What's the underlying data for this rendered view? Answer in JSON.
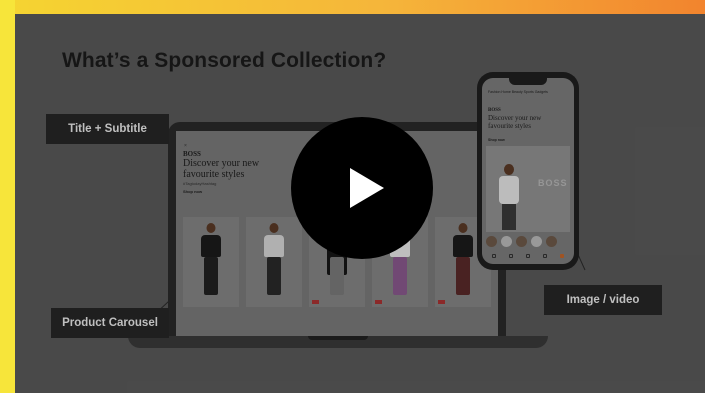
{
  "video": {
    "heading": "What’s a Sponsored Collection?",
    "callouts": {
      "title_subtitle": "Title + Subtitle",
      "product_carousel": "Product Carousel",
      "image_video": "Image / video"
    },
    "play_icon": "play-icon"
  },
  "laptop": {
    "brand": "BOSS",
    "subtitle": "Discover your new favourite styles",
    "tag": "#TagtodayHashtag",
    "shop": "Shop now"
  },
  "phone": {
    "tabs": "Fashion  Home  Beauty  Sports  Gadgets",
    "brand": "BOSS",
    "subtitle": "Discover your new favourite styles",
    "shop": "Shop now",
    "hero_text": "BOSS"
  },
  "colors": {
    "frame_yellow": "#f7e53a",
    "frame_orange": "#f2842e",
    "overlay": "#5a5a5a",
    "callout_bg": "#262626",
    "play_bg": "#000000"
  }
}
